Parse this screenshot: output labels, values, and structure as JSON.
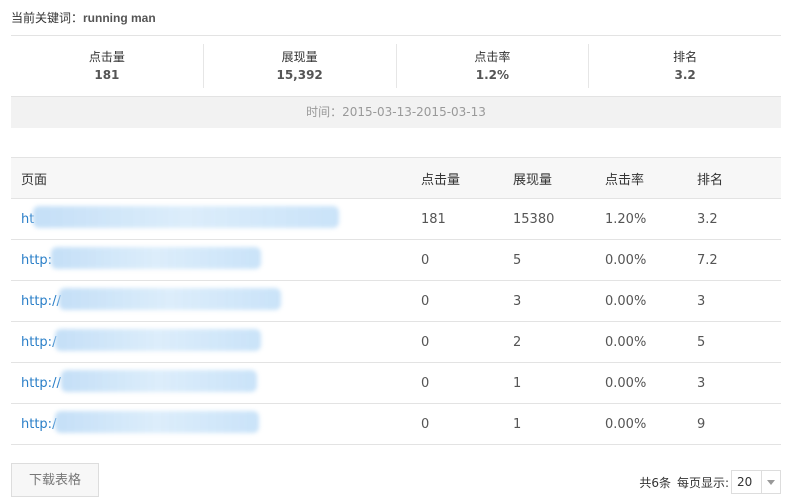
{
  "keyword": {
    "label": "当前关键词：",
    "value": "running man"
  },
  "stats": [
    {
      "label": "点击量",
      "value": "181"
    },
    {
      "label": "展现量",
      "value": "15,392"
    },
    {
      "label": "点击率",
      "value": "1.2%"
    },
    {
      "label": "排名",
      "value": "3.2"
    }
  ],
  "time": "时间：2015-03-13-2015-03-13",
  "table": {
    "headers": [
      "页面",
      "点击量",
      "展现量",
      "点击率",
      "排名"
    ],
    "rows": [
      {
        "page": "ht",
        "clicks": "181",
        "impressions": "15380",
        "ctr": "1.20%",
        "rank": "3.2"
      },
      {
        "page": "http:",
        "clicks": "0",
        "impressions": "5",
        "ctr": "0.00%",
        "rank": "7.2"
      },
      {
        "page": "http://",
        "clicks": "0",
        "impressions": "3",
        "ctr": "0.00%",
        "rank": "3"
      },
      {
        "page": "http:/",
        "clicks": "0",
        "impressions": "2",
        "ctr": "0.00%",
        "rank": "5"
      },
      {
        "page": "http://",
        "clicks": "0",
        "impressions": "1",
        "ctr": "0.00%",
        "rank": "3"
      },
      {
        "page": "http:/",
        "clicks": "0",
        "impressions": "1",
        "ctr": "0.00%",
        "rank": "9"
      }
    ]
  },
  "download_label": "下载表格",
  "pager": {
    "total": "共6条",
    "per_page_label": "每页显示:",
    "per_page_value": "20"
  },
  "colors": {
    "link": "#2a7fc8",
    "time_bar_bg": "#f2f2f2",
    "header_bg": "#f7f7f7"
  }
}
